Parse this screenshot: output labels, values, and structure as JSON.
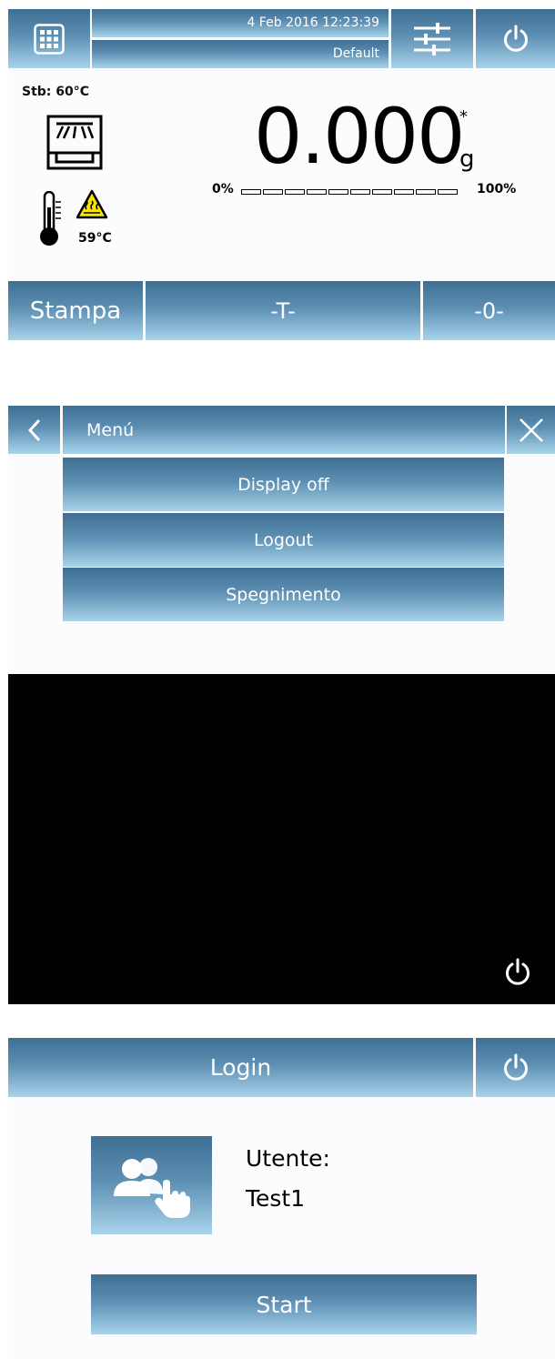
{
  "weighing": {
    "datetime": "4 Feb 2016 12:23:39",
    "profile": "Default",
    "stability": "Stb: 60°C",
    "weight": "0.000",
    "stable_mark": "*",
    "unit": "g",
    "range_min": "0%",
    "range_max": "100%",
    "capacity_fraction": 0,
    "capacity_segments": 10,
    "temperature": "59°C",
    "buttons": {
      "print": "Stampa",
      "tare": "-T-",
      "zero": "-0-"
    },
    "icons": [
      "grid-menu-icon",
      "settings-sliders-icon",
      "power-icon",
      "drying-chamber-icon",
      "thermometer-icon",
      "hot-surface-warning-icon"
    ]
  },
  "menu": {
    "title": "Menú",
    "items": [
      "Display off",
      "Logout",
      "Spegnimento"
    ],
    "icons": [
      "back-chevron-icon",
      "close-icon"
    ]
  },
  "display_off": {
    "icons": [
      "power-icon"
    ]
  },
  "login": {
    "title": "Login",
    "user_label": "Utente:",
    "user_name": "Test1",
    "start": "Start",
    "icons": [
      "power-icon",
      "user-select-icon"
    ]
  },
  "colors": {
    "button_top": "#3f6e93",
    "button_bottom": "#a8d4ea",
    "background": "#fcfbfd",
    "warning": "#f5e500"
  }
}
